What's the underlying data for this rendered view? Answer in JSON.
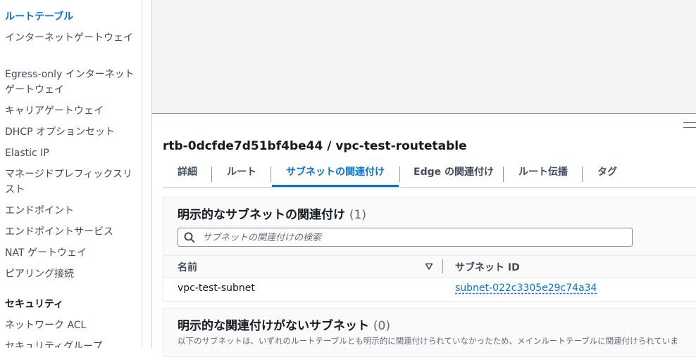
{
  "sidebar": {
    "items": [
      {
        "label": "ルートテーブル",
        "active": true
      },
      {
        "label": "インターネットゲートウェイ"
      },
      {
        "label": "Egress-only インターネットゲートウェイ"
      },
      {
        "label": "キャリアゲートウェイ"
      },
      {
        "label": "DHCP オプションセット"
      },
      {
        "label": "Elastic IP"
      },
      {
        "label": "マネージドプレフィックスリスト"
      },
      {
        "label": "エンドポイント"
      },
      {
        "label": "エンドポイントサービス"
      },
      {
        "label": "NAT ゲートウェイ"
      },
      {
        "label": "ピアリング接続"
      }
    ],
    "section_security": "セキュリティ",
    "security_items": [
      {
        "label": "ネットワーク ACL"
      },
      {
        "label": "セキュリティグループ"
      }
    ]
  },
  "detail": {
    "title": "rtb-0dcfde7d51bf4be44 / vpc-test-routetable",
    "tabs": [
      {
        "label": "詳細"
      },
      {
        "label": "ルート"
      },
      {
        "label": "サブネットの関連付け",
        "active": true
      },
      {
        "label": "Edge の関連付け"
      },
      {
        "label": "ルート伝播"
      },
      {
        "label": "タグ"
      }
    ]
  },
  "explicit": {
    "title": "明示的なサブネットの関連付け",
    "count": "(1)",
    "search_placeholder": "サブネットの関連付けの検索",
    "columns": [
      "名前",
      "サブネット ID"
    ],
    "rows": [
      {
        "name": "vpc-test-subnet",
        "subnet_id": "subnet-022c3305e29c74a34"
      }
    ]
  },
  "no_explicit": {
    "title": "明示的な関連付けがないサブネット",
    "count": "(0)",
    "description": "以下のサブネットは、いずれのルートテーブルとも明示的に関連付けられていなかったため、メインルートテーブルに関連付けられていま"
  },
  "colors": {
    "accent": "#0972d3",
    "text": "#16191f",
    "muted": "#414d5c"
  },
  "icons": {
    "search": "search-icon",
    "sort": "sort-desc-icon",
    "resize": "resize-handle-icon"
  }
}
